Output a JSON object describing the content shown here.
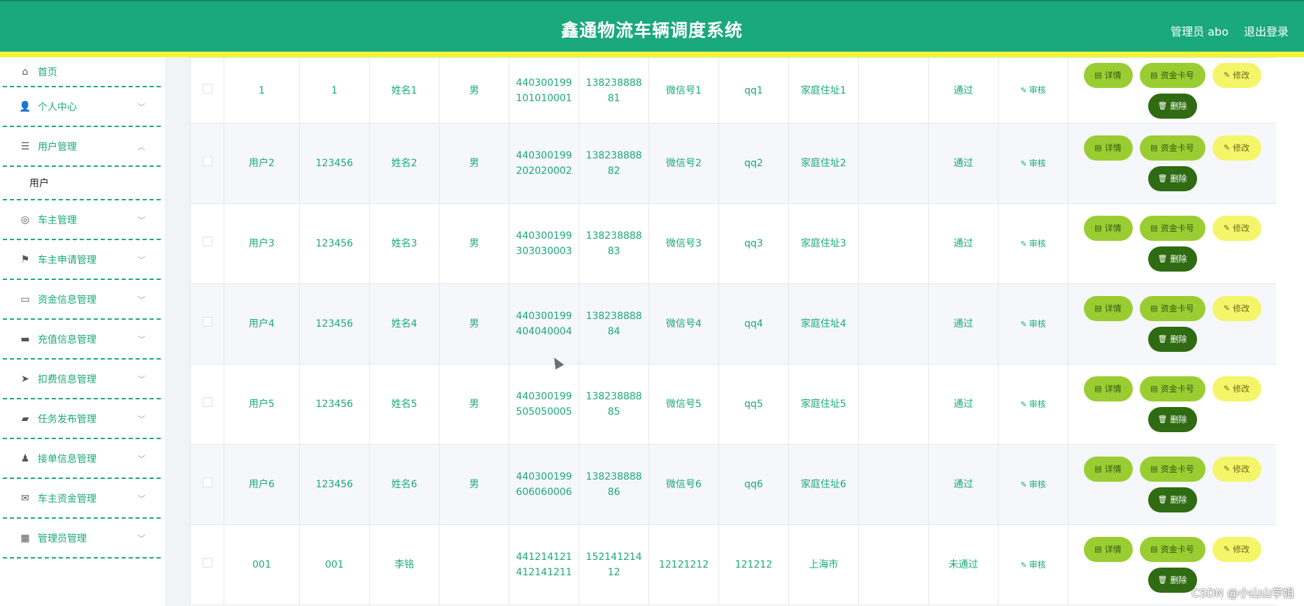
{
  "header": {
    "title": "鑫通物流车辆调度系统",
    "user": "管理员 abo",
    "logout": "退出登录"
  },
  "sidebar": {
    "items": [
      {
        "label": "首页",
        "icon": "home-icon"
      },
      {
        "label": "个人中心",
        "icon": "user-icon"
      },
      {
        "label": "用户管理",
        "icon": "menu-icon"
      },
      {
        "label": "车主管理",
        "icon": "compass-icon"
      },
      {
        "label": "车主申请管理",
        "icon": "flag-icon"
      },
      {
        "label": "资金信息管理",
        "icon": "chat-icon"
      },
      {
        "label": "充值信息管理",
        "icon": "message-icon"
      },
      {
        "label": "扣费信息管理",
        "icon": "send-icon"
      },
      {
        "label": "任务发布管理",
        "icon": "ticket-icon"
      },
      {
        "label": "接单信息管理",
        "icon": "person-icon"
      },
      {
        "label": "车主资金管理",
        "icon": "mail-icon"
      },
      {
        "label": "管理员管理",
        "icon": "grid-icon"
      }
    ],
    "subitem": "用户"
  },
  "table": {
    "rows": [
      {
        "account": "1",
        "password": "1",
        "name": "姓名1",
        "gender": "男",
        "id_card": [
          "440300199",
          "101010001"
        ],
        "phone": [
          "138238888",
          "81"
        ],
        "wechat": "微信号1",
        "qq": "qq1",
        "address": "家庭住址1",
        "blank": "",
        "status": "通过"
      },
      {
        "account": "用户2",
        "password": "123456",
        "name": "姓名2",
        "gender": "男",
        "id_card": [
          "440300199",
          "202020002"
        ],
        "phone": [
          "138238888",
          "82"
        ],
        "wechat": "微信号2",
        "qq": "qq2",
        "address": "家庭住址2",
        "blank": "",
        "status": "通过"
      },
      {
        "account": "用户3",
        "password": "123456",
        "name": "姓名3",
        "gender": "男",
        "id_card": [
          "440300199",
          "303030003"
        ],
        "phone": [
          "138238888",
          "83"
        ],
        "wechat": "微信号3",
        "qq": "qq3",
        "address": "家庭住址3",
        "blank": "",
        "status": "通过"
      },
      {
        "account": "用户4",
        "password": "123456",
        "name": "姓名4",
        "gender": "男",
        "id_card": [
          "440300199",
          "404040004"
        ],
        "phone": [
          "138238888",
          "84"
        ],
        "wechat": "微信号4",
        "qq": "qq4",
        "address": "家庭住址4",
        "blank": "",
        "status": "通过"
      },
      {
        "account": "用户5",
        "password": "123456",
        "name": "姓名5",
        "gender": "男",
        "id_card": [
          "440300199",
          "505050005"
        ],
        "phone": [
          "138238888",
          "85"
        ],
        "wechat": "微信号5",
        "qq": "qq5",
        "address": "家庭住址5",
        "blank": "",
        "status": "通过"
      },
      {
        "account": "用户6",
        "password": "123456",
        "name": "姓名6",
        "gender": "男",
        "id_card": [
          "440300199",
          "606060006"
        ],
        "phone": [
          "138238888",
          "86"
        ],
        "wechat": "微信号6",
        "qq": "qq6",
        "address": "家庭住址6",
        "blank": "",
        "status": "通过"
      },
      {
        "account": "001",
        "password": "001",
        "name": "李铭",
        "gender": "",
        "id_card": [
          "441214121",
          "412141211"
        ],
        "phone": [
          "152141214",
          "12"
        ],
        "wechat": "12121212",
        "qq": "121212",
        "address": "上海市",
        "blank": "",
        "status": "未通过"
      }
    ],
    "audit_label": "审核",
    "buttons": {
      "detail": "详情",
      "card": "资金卡号",
      "edit": "修改",
      "delete": "删除"
    }
  },
  "watermark": "CSDN @小山山学姐",
  "colors": {
    "primary": "#1aa97a",
    "accent_strip": "#f0f53a",
    "btn_green": "#9acd32",
    "btn_yellow": "#f5f56a",
    "btn_dark": "#2f6b12"
  }
}
